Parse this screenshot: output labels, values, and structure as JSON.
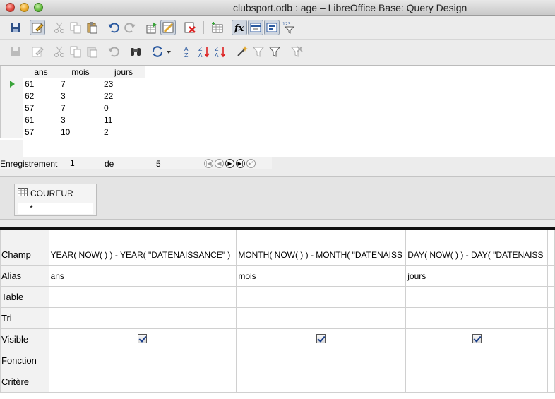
{
  "window": {
    "title": "clubsport.odb : age – LibreOffice Base: Query Design"
  },
  "icons": {
    "toolbar1": [
      "save-icon",
      "edit-icon",
      "cut-icon",
      "copy-icon",
      "paste-icon",
      "undo-icon",
      "redo-icon",
      "run-query-icon",
      "design-view-icon",
      "clear-query-icon",
      "add-table-icon",
      "functions-icon",
      "table-name-icon",
      "alias-icon",
      "distinct-values-icon"
    ],
    "toolbar2": [
      "save-record-icon",
      "edit-data-icon",
      "cut-icon",
      "copy-icon",
      "paste-icon",
      "undo-icon",
      "find-record-icon",
      "refresh-icon",
      "sort-ascending-icon",
      "sort-descending-icon",
      "sort-icon",
      "autofilter-icon",
      "apply-filter-icon",
      "standard-filter-icon",
      "remove-filter-icon"
    ]
  },
  "results": {
    "columns": [
      "ans",
      "mois",
      "jours"
    ],
    "rows": [
      [
        "61",
        "7",
        "23"
      ],
      [
        "62",
        "3",
        "22"
      ],
      [
        "57",
        "7",
        "0"
      ],
      [
        "61",
        "3",
        "11"
      ],
      [
        "57",
        "10",
        "2"
      ]
    ],
    "nav": {
      "label": "Enregistrement",
      "current": "1",
      "of_label": "de",
      "total": "5"
    }
  },
  "table_pane": {
    "table_name": "COUREUR",
    "field": "*"
  },
  "design": {
    "row_labels": [
      "Champ",
      "Alias",
      "Table",
      "Tri",
      "Visible",
      "Fonction",
      "Critère"
    ],
    "columns": [
      {
        "champ": "YEAR( NOW( ) ) - YEAR( \"DATENAISSANCE\" )",
        "alias": "ans",
        "visible": true
      },
      {
        "champ": "MONTH( NOW( ) ) - MONTH( \"DATENAISS",
        "alias": "mois",
        "visible": true
      },
      {
        "champ": "DAY( NOW( ) ) - DAY( \"DATENAISS",
        "alias": "jours",
        "visible": true
      }
    ]
  }
}
